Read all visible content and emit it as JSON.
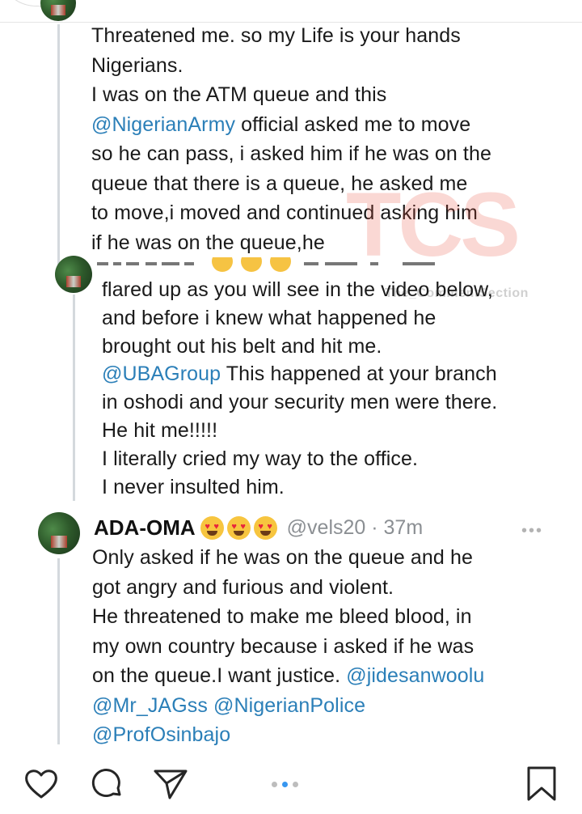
{
  "thread": {
    "first_tweet_lines": [
      "Threatened me. so my Life is your hands",
      "Nigerians.",
      "I was on the ATM queue and this",
      [
        "@NigerianArmy",
        " official asked me to move"
      ],
      "so he can pass, i asked him if he was on the",
      "queue that there is a queue, he asked me",
      "to move,i moved and continued asking him",
      "if he was on the queue,he"
    ],
    "second_tweet_lines": [
      "flared up as you will see in the video below,",
      "and before i knew what happened he",
      "brought out his belt and hit me.",
      [
        "@UBAGroup",
        " This happened at your branch"
      ],
      "in oshodi and your security men were there.",
      "He hit me!!!!!",
      "I literally cried my way to the office.",
      "I never insulted him."
    ],
    "third_tweet": {
      "author": "ADA-OMA",
      "handle_time": "@vels20 · 37m",
      "more": "•••",
      "lines": [
        "Only asked if he was on the queue and he",
        "got angry and furious and violent.",
        "He threatened to make me bleed blood, in",
        "my own country because i asked if he was",
        [
          "on the queue.I want justice. ",
          "@jidesanwoolu"
        ],
        [
          "@Mr_JAGss",
          " ",
          "@NigerianPolice"
        ],
        [
          "@ProfOsinbajo"
        ]
      ]
    }
  },
  "watermark": {
    "letters": "TCS",
    "subtitle": "The_CommentSection"
  },
  "colors": {
    "mention": "#2b7fb8",
    "pager_active": "#3897f0",
    "thread_line": "#d4d9dd"
  },
  "actions": {
    "like_icon": "heart-icon",
    "comment_icon": "comment-icon",
    "share_icon": "paper-plane-icon",
    "save_icon": "bookmark-icon",
    "pager": {
      "count": 3,
      "active_index": 1
    }
  }
}
